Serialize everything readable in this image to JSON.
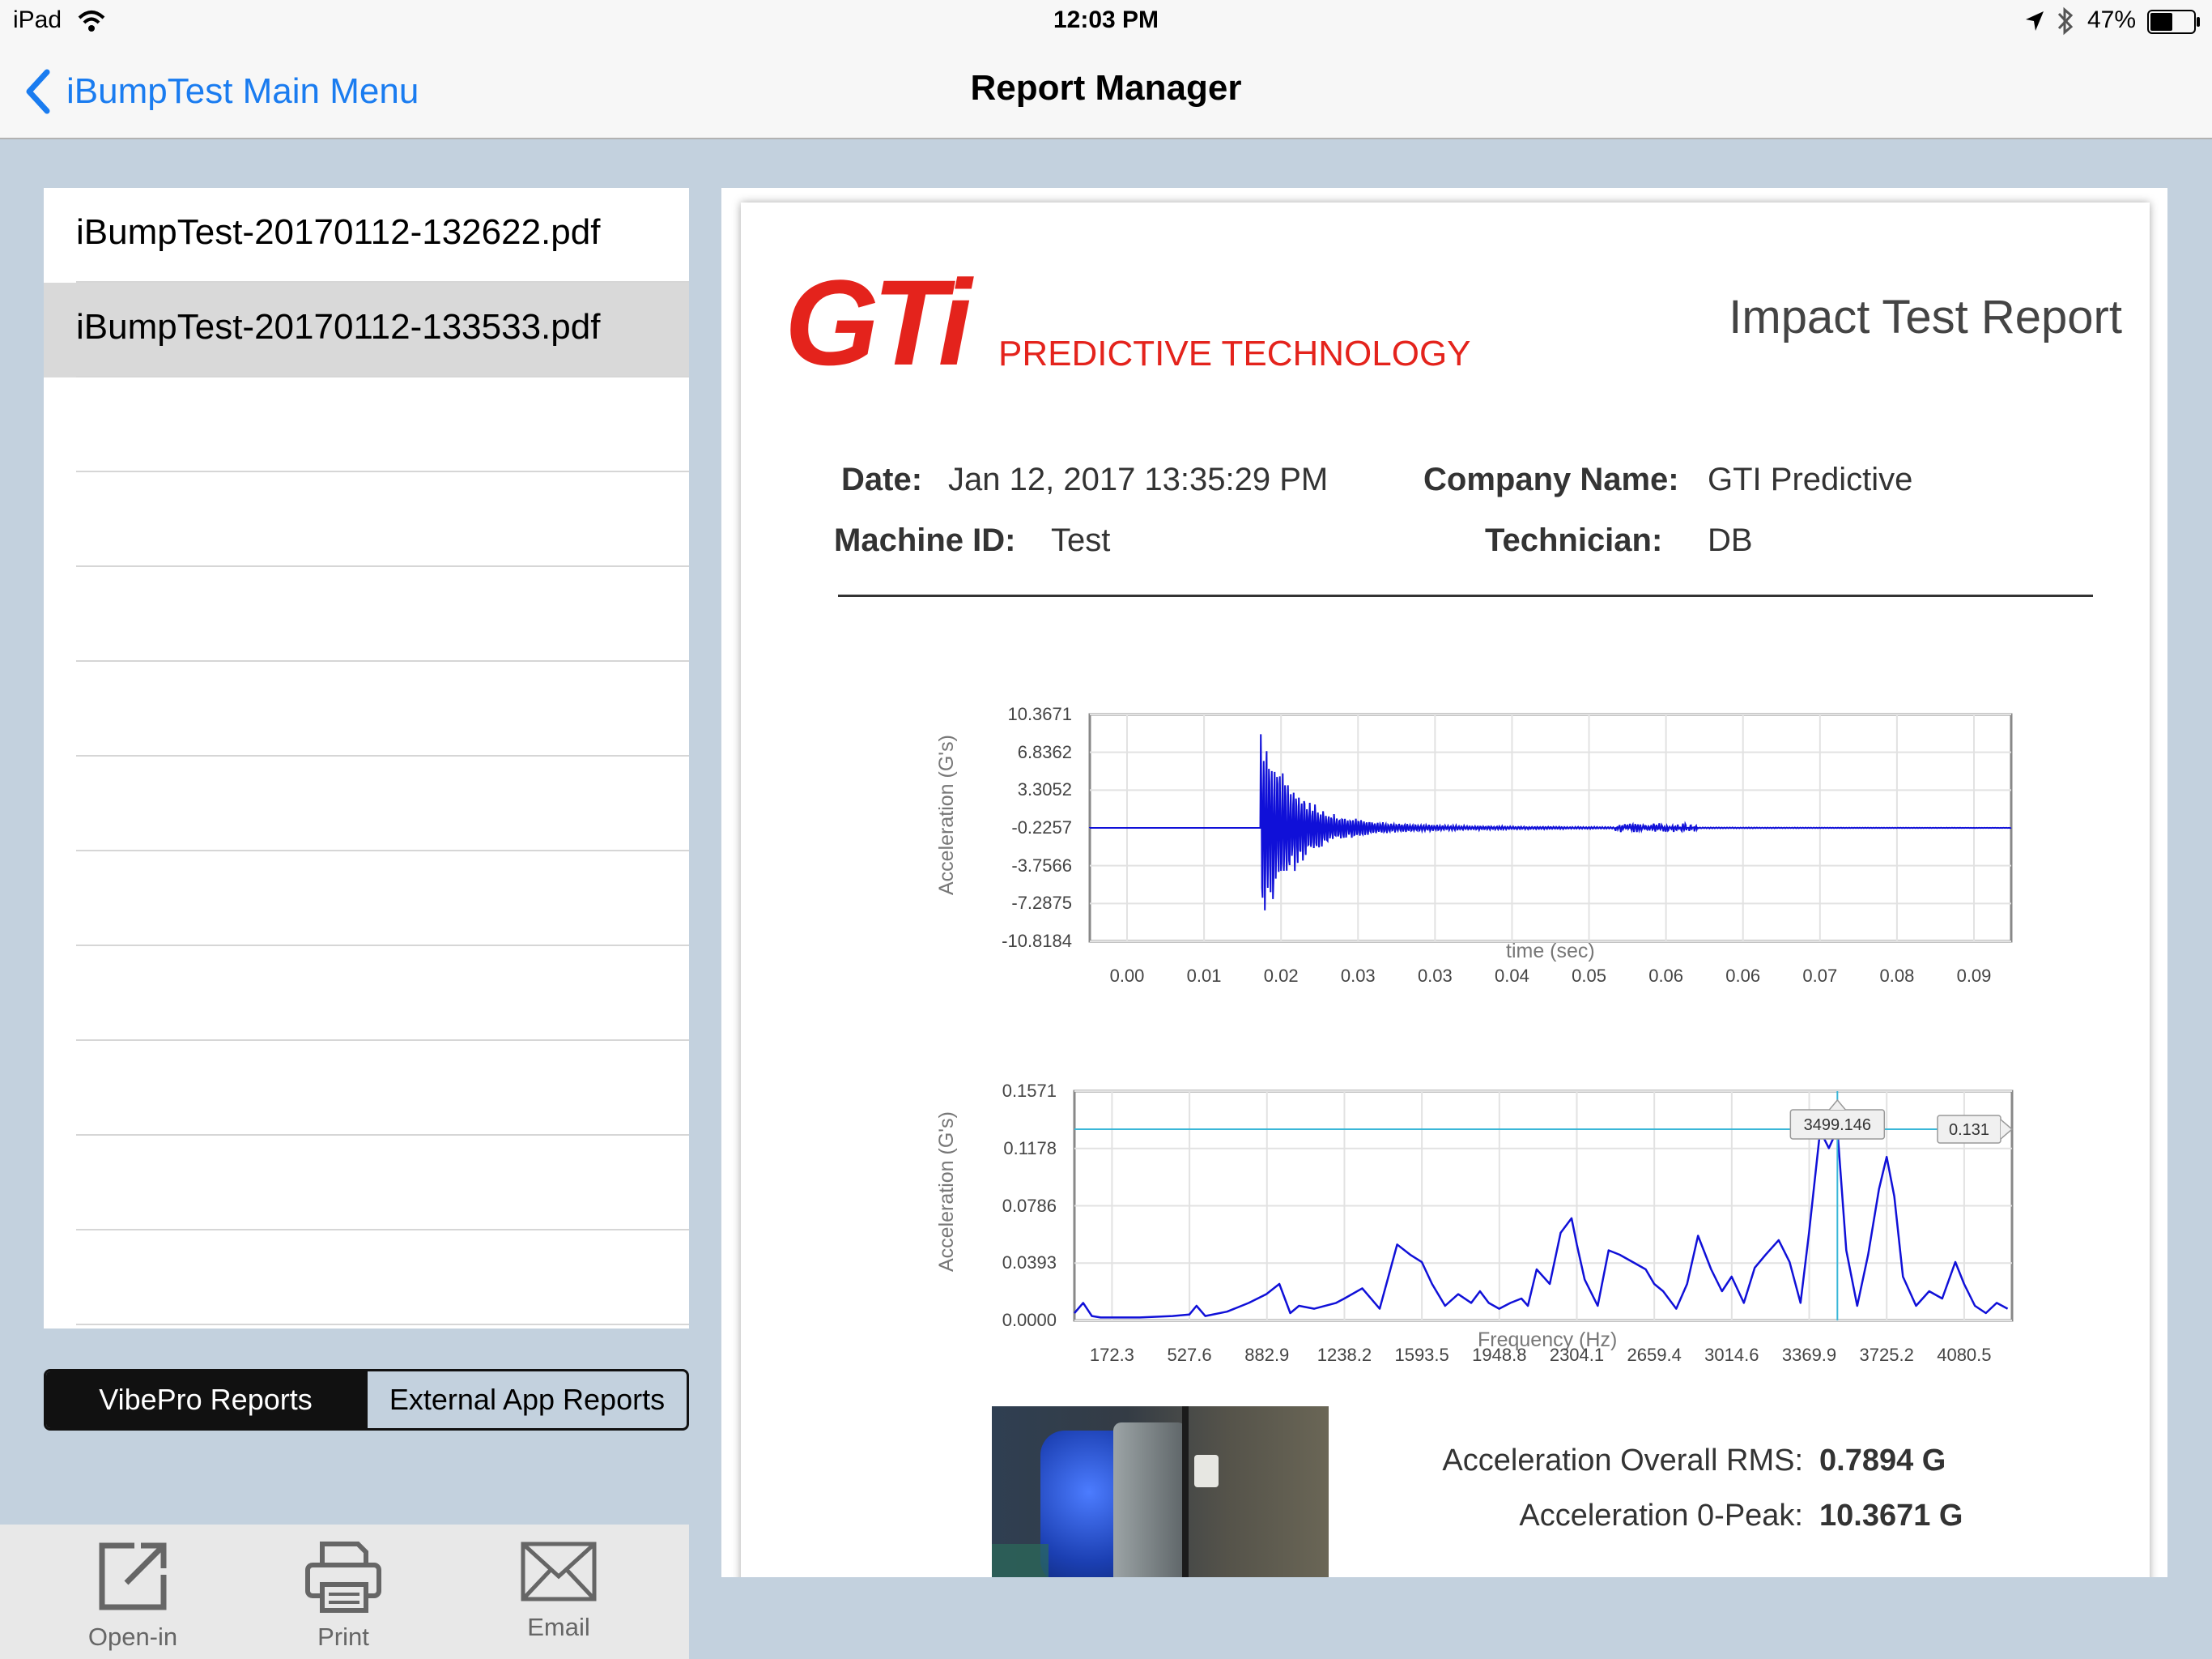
{
  "status_bar": {
    "device": "iPad",
    "time": "12:03 PM",
    "battery": "47%"
  },
  "nav": {
    "back_label": "iBumpTest Main Menu",
    "title": "Report Manager"
  },
  "file_list": {
    "items": [
      {
        "label": "iBumpTest-20170112-132622.pdf",
        "selected": false
      },
      {
        "label": "iBumpTest-20170112-133533.pdf",
        "selected": true
      }
    ]
  },
  "segment": {
    "options": [
      "VibePro Reports",
      "External App Reports"
    ],
    "active_index": 0
  },
  "toolbar": {
    "open_in": "Open-in",
    "print": "Print",
    "email": "Email"
  },
  "report": {
    "logo_text": "GTi",
    "logo_subtitle": "PREDICTIVE TECHNOLOGY",
    "title": "Impact Test Report",
    "date_label": "Date:",
    "date_value": "Jan 12, 2017  13:35:29 PM",
    "company_label": "Company Name:",
    "company_value": "GTI Predictive",
    "machine_label": "Machine ID:",
    "machine_value": "Test",
    "tech_label": "Technician:",
    "tech_value": "DB",
    "stats": {
      "rms_label": "Acceleration Overall RMS:",
      "rms_value": "0.7894 G",
      "peak_label": "Acceleration 0-Peak:",
      "peak_value": "10.3671 G"
    }
  },
  "chart_data": [
    {
      "type": "line",
      "xlabel": "time (sec)",
      "ylabel": "Acceleration (G's)",
      "y_ticks": [
        "10.3671",
        "6.8362",
        "3.3052",
        "-0.2257",
        "-3.7566",
        "-7.2875",
        "-10.8184"
      ],
      "x_ticks": [
        "0.00",
        "0.01",
        "0.02",
        "0.03",
        "0.03",
        "0.04",
        "0.05",
        "0.06",
        "0.06",
        "0.07",
        "0.08",
        "0.09"
      ],
      "ylim": [
        -10.8184,
        10.3671
      ],
      "xlim": [
        0,
        0.1
      ],
      "color": "#1010d8",
      "description_points": {
        "impact_time": 0.0185,
        "baseline": -0.2257,
        "peak_max": 10.3671,
        "peak_min": -10.8184
      }
    },
    {
      "type": "line",
      "xlabel": "Frequency (Hz)",
      "ylabel": "Acceleration (G's)",
      "y_ticks": [
        "0.1571",
        "0.1178",
        "0.0786",
        "0.0393",
        "0.0000"
      ],
      "x_ticks": [
        "172.3",
        "527.6",
        "882.9",
        "1238.2",
        "1593.5",
        "1948.8",
        "2304.1",
        "2659.4",
        "3014.6",
        "3369.9",
        "3725.2",
        "4080.5"
      ],
      "ylim": [
        0,
        0.1571
      ],
      "xlim": [
        0,
        4300
      ],
      "color": "#1010d8",
      "cursor": {
        "x": 3499.146,
        "x_label": "3499.146",
        "y": 0.131,
        "y_label": "0.131",
        "color": "#3ab7d8"
      },
      "x": [
        0,
        40,
        80,
        120,
        172,
        300,
        450,
        527,
        560,
        600,
        700,
        800,
        880,
        940,
        990,
        1030,
        1100,
        1200,
        1238,
        1320,
        1400,
        1440,
        1480,
        1540,
        1593,
        1640,
        1700,
        1760,
        1820,
        1860,
        1900,
        1948,
        2000,
        2050,
        2080,
        2120,
        2180,
        2230,
        2280,
        2304,
        2340,
        2400,
        2450,
        2500,
        2560,
        2620,
        2659,
        2700,
        2760,
        2810,
        2860,
        2920,
        2970,
        3014,
        3070,
        3120,
        3170,
        3230,
        3280,
        3330,
        3369,
        3420,
        3460,
        3499,
        3540,
        3590,
        3640,
        3690,
        3725,
        3760,
        3800,
        3860,
        3920,
        3980,
        4040,
        4080,
        4130,
        4180,
        4230,
        4280
      ],
      "y": [
        0.005,
        0.012,
        0.003,
        0.002,
        0.002,
        0.002,
        0.003,
        0.004,
        0.01,
        0.003,
        0.006,
        0.012,
        0.018,
        0.025,
        0.005,
        0.01,
        0.008,
        0.012,
        0.015,
        0.022,
        0.008,
        0.03,
        0.052,
        0.045,
        0.04,
        0.025,
        0.01,
        0.018,
        0.012,
        0.02,
        0.012,
        0.008,
        0.012,
        0.015,
        0.01,
        0.035,
        0.025,
        0.06,
        0.07,
        0.052,
        0.028,
        0.01,
        0.048,
        0.045,
        0.04,
        0.035,
        0.025,
        0.02,
        0.008,
        0.025,
        0.058,
        0.035,
        0.02,
        0.03,
        0.012,
        0.036,
        0.045,
        0.055,
        0.04,
        0.012,
        0.06,
        0.13,
        0.118,
        0.131,
        0.048,
        0.01,
        0.045,
        0.09,
        0.112,
        0.085,
        0.03,
        0.01,
        0.02,
        0.015,
        0.04,
        0.025,
        0.01,
        0.005,
        0.012,
        0.008
      ]
    }
  ]
}
